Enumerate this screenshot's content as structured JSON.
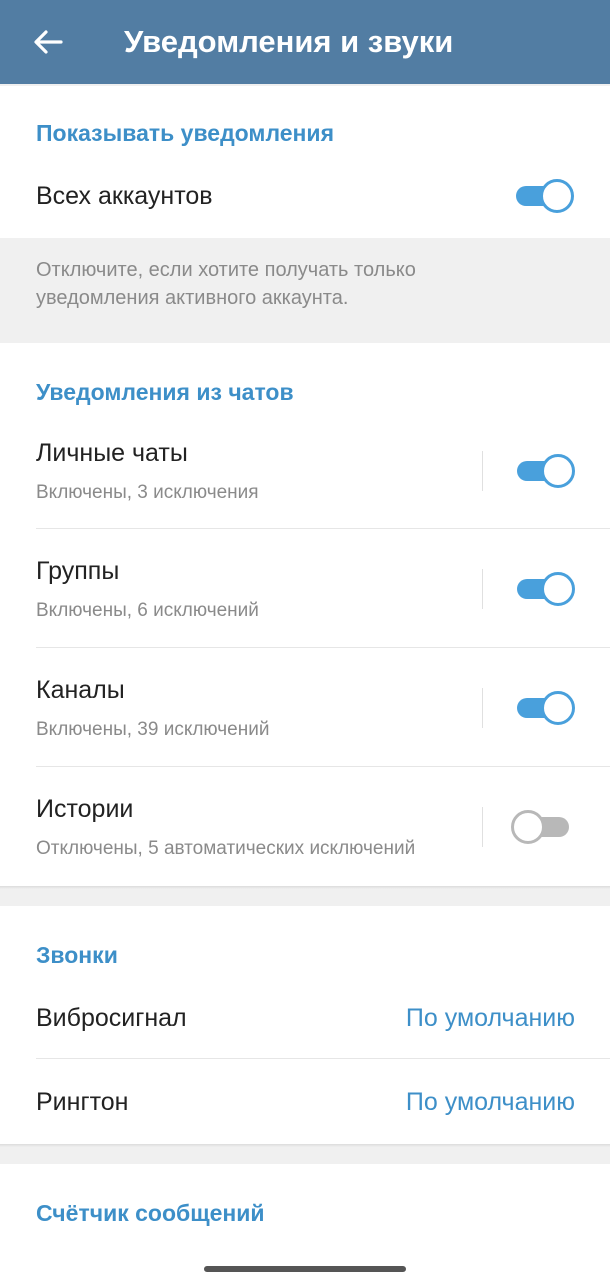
{
  "header": {
    "title": "Уведомления и звуки"
  },
  "show_notifications": {
    "header": "Показывать уведомления",
    "all_accounts": {
      "label": "Всех аккаунтов",
      "enabled": true
    },
    "hint_line1": "Отключите, если хотите получать только",
    "hint_line2": "уведомления активного аккаунта."
  },
  "chat_notifications": {
    "header": "Уведомления из чатов",
    "items": [
      {
        "title": "Личные чаты",
        "subtitle": "Включены, 3 исключения",
        "enabled": true
      },
      {
        "title": "Группы",
        "subtitle": "Включены, 6 исключений",
        "enabled": true
      },
      {
        "title": "Каналы",
        "subtitle": "Включены, 39 исключений",
        "enabled": true
      },
      {
        "title": "Истории",
        "subtitle": "Отключены, 5 автоматических исключений",
        "enabled": false
      }
    ]
  },
  "calls": {
    "header": "Звонки",
    "items": [
      {
        "title": "Вибросигнал",
        "value": "По умолчанию"
      },
      {
        "title": "Рингтон",
        "value": "По умолчанию"
      }
    ]
  },
  "badge_counter": {
    "header": "Счётчик сообщений"
  },
  "colors": {
    "appbar": "#527da3",
    "accent": "#3d8fc8",
    "toggle_on": "#49a0dc",
    "toggle_off": "#b8b8b8"
  }
}
